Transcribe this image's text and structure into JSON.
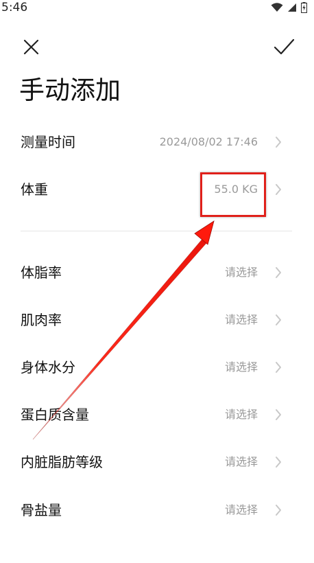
{
  "status_bar": {
    "time": "5:46"
  },
  "page": {
    "title": "手动添加"
  },
  "rows": [
    {
      "label": "测量时间",
      "value": "2024/08/02 17:46"
    },
    {
      "label": "体重",
      "value": "55.0 KG"
    },
    {
      "label": "体脂率",
      "value": "请选择"
    },
    {
      "label": "肌肉率",
      "value": "请选择"
    },
    {
      "label": "身体水分",
      "value": "请选择"
    },
    {
      "label": "蛋白质含量",
      "value": "请选择"
    },
    {
      "label": "内脏脂肪等级",
      "value": "请选择"
    },
    {
      "label": "骨盐量",
      "value": "请选择"
    }
  ],
  "icons": {
    "close": "close-icon",
    "confirm": "check-icon",
    "chevron": "chevron-right-icon",
    "wifi": "wifi-icon",
    "signal": "signal-icon",
    "battery": "battery-charging-icon"
  },
  "colors": {
    "annotation_red": "#e0201a",
    "value_gray": "#9a9a9a"
  }
}
